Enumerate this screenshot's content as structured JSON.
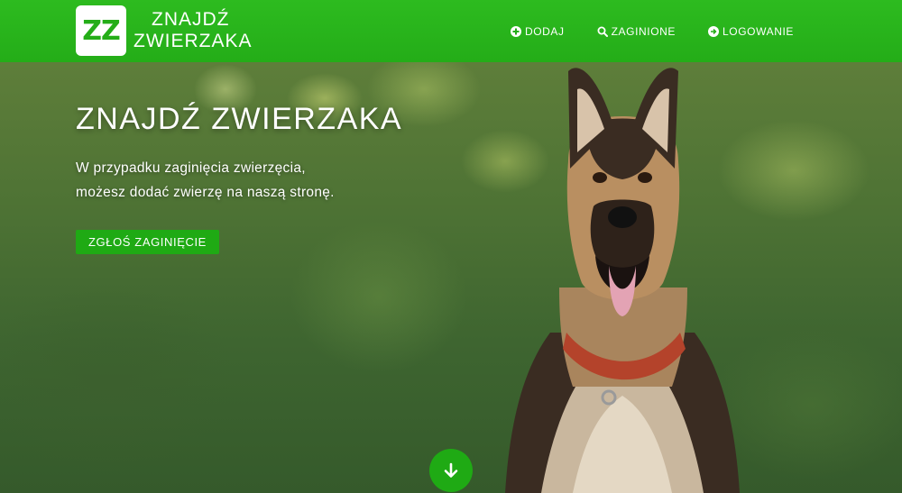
{
  "brand": {
    "logo_text": "ZZ",
    "name_line1": "ZNAJDŹ",
    "name_line2": "ZWIERZAKA"
  },
  "nav": {
    "items": [
      {
        "label": "DODAJ",
        "icon": "plus-circle-icon"
      },
      {
        "label": "ZAGINIONE",
        "icon": "search-icon"
      },
      {
        "label": "LOGOWANIE",
        "icon": "arrow-right-circle-icon"
      }
    ]
  },
  "hero": {
    "title": "ZNAJDŹ ZWIERZAKA",
    "text_line1": "W przypadku zaginięcia zwierzęcia,",
    "text_line2": "możesz dodać zwierzę na naszą stronę.",
    "cta_label": "ZGŁOŚ ZAGINIĘCIE",
    "scroll_icon": "arrow-down-icon"
  },
  "colors": {
    "brand_green": "#24ad18",
    "button_green": "#1faa14",
    "text": "#ffffff"
  }
}
